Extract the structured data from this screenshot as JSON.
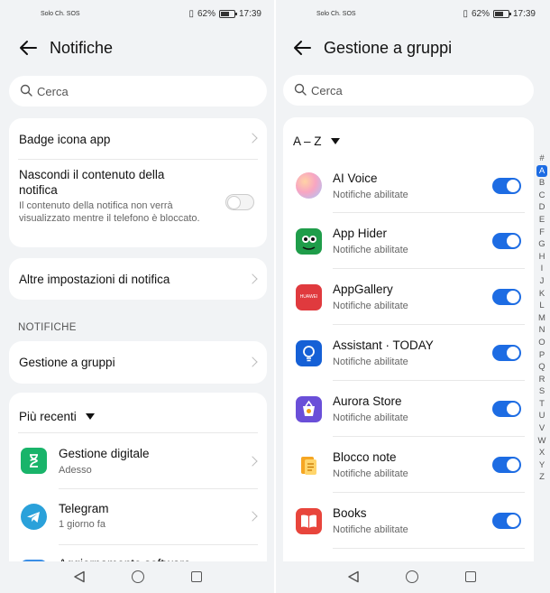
{
  "status_bar": {
    "carrier": "Solo Ch. SOS",
    "battery": "62%",
    "time": "17:39"
  },
  "left": {
    "title": "Notifiche",
    "search_placeholder": "Cerca",
    "rows": {
      "badge": "Badge icona app",
      "hide_title": "Nascondi il contenuto della notifica",
      "hide_sub": "Il contenuto della notifica non verrà visualizzato mentre il telefono è bloccato.",
      "more": "Altre impostazioni di notifica"
    },
    "section_label": "NOTIFICHE",
    "group_mgmt": "Gestione a gruppi",
    "sort_label": "Più recenti",
    "recent_apps": [
      {
        "name": "Gestione digitale",
        "time": "Adesso",
        "icon": "hourglass-icon"
      },
      {
        "name": "Telegram",
        "time": "1 giorno fa",
        "icon": "telegram-icon"
      },
      {
        "name": "Aggiornamento software",
        "time": "",
        "icon": "update-icon"
      }
    ]
  },
  "right": {
    "title": "Gestione a gruppi",
    "search_placeholder": "Cerca",
    "sort_label": "A – Z",
    "apps": [
      {
        "name": "AI Voice",
        "status": "Notifiche abilitate",
        "enabled": true,
        "icon": "ai-voice-icon"
      },
      {
        "name": "App Hider",
        "status": "Notifiche abilitate",
        "enabled": true,
        "icon": "app-hider-icon"
      },
      {
        "name": "AppGallery",
        "status": "Notifiche abilitate",
        "enabled": true,
        "icon": "appgallery-icon",
        "icon_text": "HUAWEI"
      },
      {
        "name": "Assistant · TODAY",
        "status": "Notifiche abilitate",
        "enabled": true,
        "icon": "lightbulb-icon"
      },
      {
        "name": "Aurora Store",
        "status": "Notifiche abilitate",
        "enabled": true,
        "icon": "aurora-store-icon"
      },
      {
        "name": "Blocco note",
        "status": "Notifiche abilitate",
        "enabled": true,
        "icon": "notepad-icon"
      },
      {
        "name": "Books",
        "status": "Notifiche abilitate",
        "enabled": true,
        "icon": "books-icon"
      }
    ],
    "alphabet": [
      "#",
      "A",
      "B",
      "C",
      "D",
      "E",
      "F",
      "G",
      "H",
      "I",
      "J",
      "K",
      "L",
      "M",
      "N",
      "O",
      "P",
      "Q",
      "R",
      "S",
      "T",
      "U",
      "V",
      "W",
      "X",
      "Y",
      "Z"
    ],
    "alphabet_selected": "A"
  },
  "colors": {
    "accent": "#1d6ce3",
    "background": "#f1f3f5",
    "card": "#ffffff"
  }
}
